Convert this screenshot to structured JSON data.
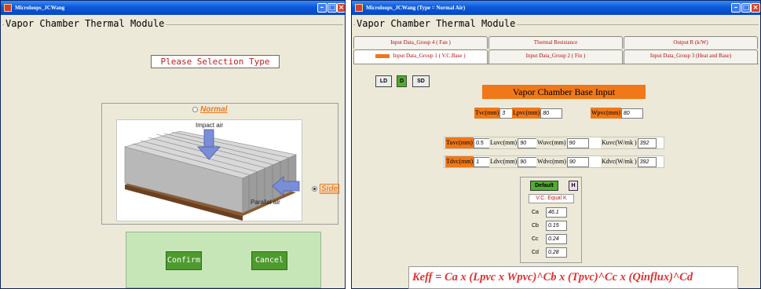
{
  "window1": {
    "title": "Microloops_JCWang",
    "frame_title": "Vapor Chamber Thermal Module",
    "selection_label": "Please Selection Type",
    "options": [
      {
        "label": "Normal",
        "selected": false
      },
      {
        "label": "Side",
        "selected": true
      }
    ],
    "figure": {
      "impact_label": "Impact air",
      "parallel_label": "Parallel air"
    },
    "buttons": {
      "confirm": "Confirm",
      "cancel": "Cancel"
    }
  },
  "window2": {
    "title": "Microloops_JCWang (Type = Normal Air)",
    "frame_title": "Vapor Chamber Thermal Module",
    "tabs_row1": [
      "Input Data_Group 4 ( Fan )",
      "Thermal Resistance",
      "Output R (k/W)"
    ],
    "tabs_row2": [
      "Input Data_Group 1 ( V.C.Base )",
      "Input Data_Group 2 ( Fin )",
      "Input Data_Group 3 (Heat and Base)"
    ],
    "active_tab": "Input Data_Group 1 ( V.C.Base )",
    "mode_buttons": [
      "LD",
      "D",
      "SD"
    ],
    "active_mode": "D",
    "banner": "Vapor Chamber Base Input",
    "row1": [
      {
        "label": "Tvc(mm)",
        "value": "3"
      },
      {
        "label": "Lpvc(mm)",
        "value": "80"
      },
      {
        "label": "Wpvc(mm)",
        "value": "80"
      }
    ],
    "row2": [
      {
        "label": "Tuvc(mm)",
        "value": "0.5"
      },
      {
        "label": "Luvc(mm)",
        "value": "90"
      },
      {
        "label": "Wuvc(mm)",
        "value": "90"
      },
      {
        "label": "Kuvc(W/mk )",
        "value": "392"
      }
    ],
    "row3": [
      {
        "label": "Tdvc(mm)",
        "value": "1"
      },
      {
        "label": "Ldvc(mm)",
        "value": "90"
      },
      {
        "label": "Wdvc(mm)",
        "value": "90"
      },
      {
        "label": "Kdvc(W/mk )",
        "value": "392"
      }
    ],
    "k_panel": {
      "default_label": "Default",
      "h_label": "H",
      "equal_k": "V.C. Equal K",
      "coefficients": [
        {
          "label": "Ca",
          "value": "46.1"
        },
        {
          "label": "Cb",
          "value": "0.15"
        },
        {
          "label": "Cc",
          "value": "0.24"
        },
        {
          "label": "Cd",
          "value": "0.28"
        }
      ]
    },
    "formula": "Keff = Ca x (Lpvc x Wpvc)^Cb x (Tpvc)^Cc x (Qinflux)^Cd"
  },
  "colors": {
    "accent_orange": "#f07818",
    "button_green": "#4e9a2e",
    "panel_green": "#c6e6b8",
    "titlebar_blue": "#0b58d9",
    "label_red": "#c02020"
  }
}
